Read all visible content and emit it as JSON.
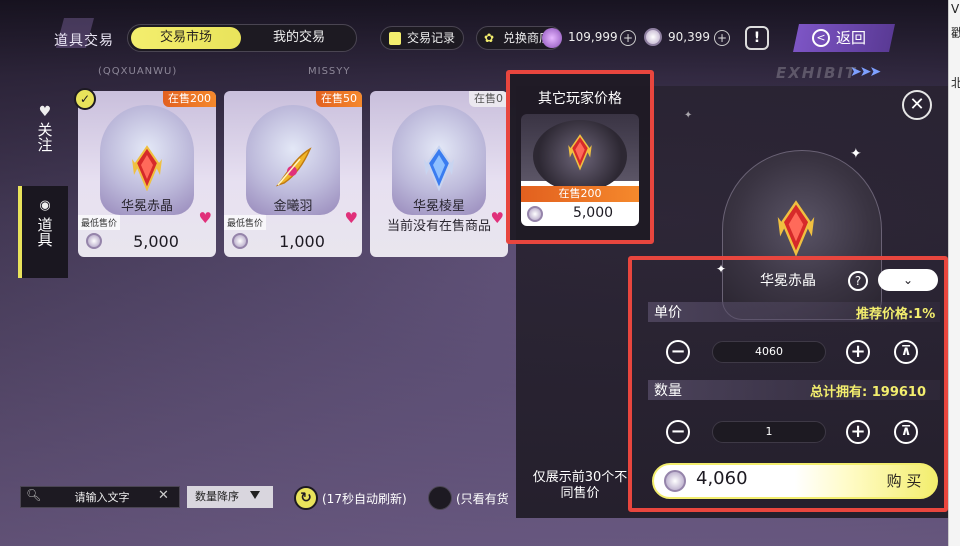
{
  "header": {
    "title": "道具交易",
    "tabs": [
      {
        "label": "交易市场",
        "active": true
      },
      {
        "label": "我的交易",
        "active": false
      }
    ],
    "record_label": "交易记录",
    "exchange_label": "兑换商店",
    "currency1": "109,999",
    "currency2": "90,399",
    "alert_label": "!",
    "back_label": "返回",
    "sub_left": "(QQXUANWU)",
    "sub_right": "MISSYY",
    "exhibit": "EXHIBIT"
  },
  "sidebar": [
    {
      "label": "关注",
      "icon": "heart-icon",
      "active": false
    },
    {
      "label": "道具",
      "icon": "item-icon",
      "active": true
    }
  ],
  "items": [
    {
      "name": "华冕赤晶",
      "stock": "在售200",
      "min_label": "最低售价",
      "price": "5,000",
      "favorite": true,
      "color": "#d62a2a"
    },
    {
      "name": "金曦羽",
      "stock": "在售50",
      "min_label": "最低售价",
      "price": "1,000",
      "favorite": true,
      "color": "#f0b52a"
    },
    {
      "name": "华冕棱星",
      "stock": "在售0",
      "no_sale": "当前没有在售商品",
      "favorite": true,
      "color": "#3a7cf0"
    }
  ],
  "others": {
    "title": "其它玩家价格",
    "stock": "在售200",
    "price": "5,000"
  },
  "detail": {
    "item_name": "华冕赤晶",
    "unit_price_label": "单价",
    "recommend": "推荐价格:1%",
    "unit_price": "4060",
    "quantity_label": "数量",
    "total_owned": "总计拥有:  199610",
    "quantity": "1",
    "note": "仅展示前30个不同售价",
    "total": "4,060",
    "buy_label": "购 买"
  },
  "toolbar": {
    "search_placeholder": "请输入文字",
    "sort_label": "数量降序",
    "refresh_label": "(17秒自动刷新)",
    "instock_label": "(只看有货"
  },
  "side_strip": [
    "V",
    "戳",
    "北"
  ],
  "colors": {
    "accent": "#f3ee6e",
    "highlight_border": "#e8463e",
    "stock_orange": "#f5892c",
    "back_purple": "#7d55c5"
  }
}
